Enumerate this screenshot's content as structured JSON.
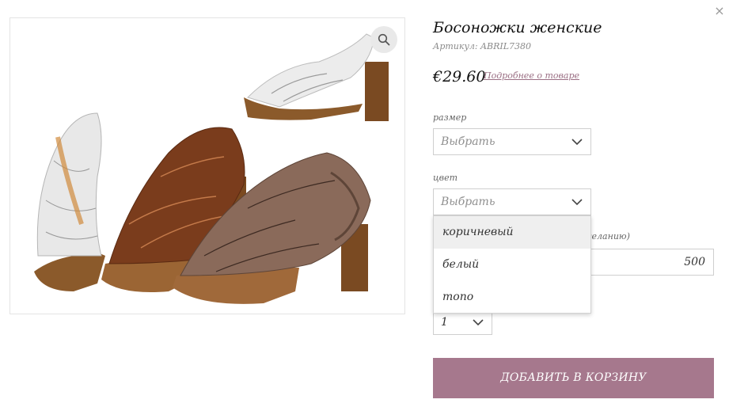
{
  "modal": {
    "close_glyph": "×"
  },
  "product": {
    "title": "Босоножки женские",
    "sku": "Артикул: ABRIL7380",
    "price": "€29.60",
    "more_link": "Подробнее о товаре",
    "image_alt": "Босоножки женские"
  },
  "options": {
    "size": {
      "label": "размер",
      "value": "Выбрать"
    },
    "color": {
      "label": "цвет",
      "value": "Выбрать",
      "open": true,
      "items": [
        "коричневый",
        "белый",
        "тоno"
      ],
      "highlighted_index": 0
    },
    "amount": {
      "label_partial": "желанию)",
      "value": "500"
    },
    "quantity": {
      "value": "1"
    }
  },
  "actions": {
    "add_to_cart": "ДОБАВИТЬ В КОРЗИНУ"
  },
  "colors": {
    "accent": "#a6788d",
    "link": "#9a6e83",
    "border": "#cfcfcf"
  },
  "icons": {
    "zoom": "search-icon",
    "close": "close-icon",
    "dropdown": "chevron-down-icon"
  }
}
